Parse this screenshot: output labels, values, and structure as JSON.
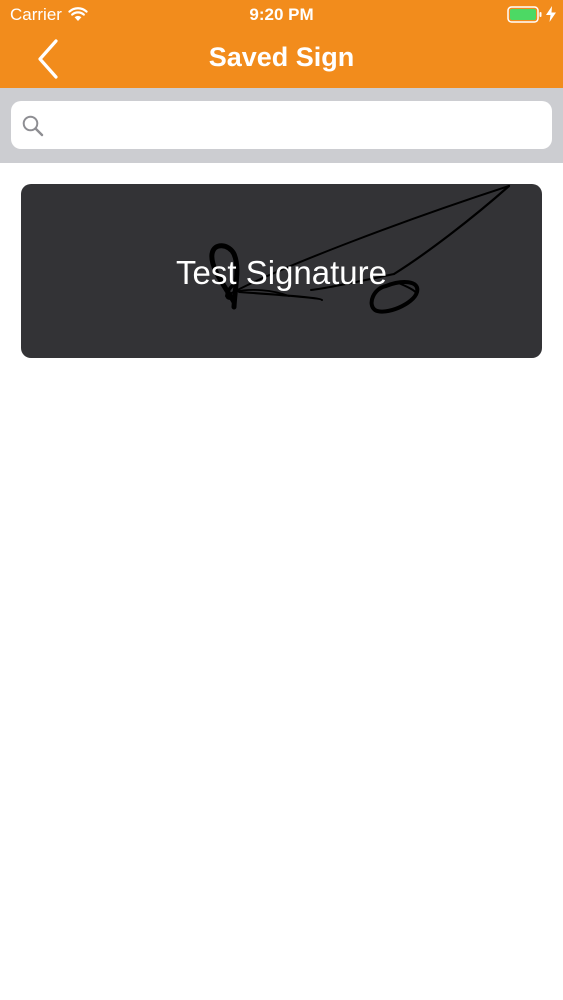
{
  "status_bar": {
    "carrier": "Carrier",
    "time": "9:20 PM",
    "icons": [
      "wifi-icon",
      "battery-icon",
      "charging-icon"
    ]
  },
  "nav_bar": {
    "title": "Saved Sign",
    "back_icon": "chevron-left-icon"
  },
  "search": {
    "placeholder": "",
    "value": "",
    "icon": "search-icon"
  },
  "signatures": [
    {
      "name": "Test Signature"
    }
  ],
  "colors": {
    "header": "#f28c1c",
    "search_area": "#cccdd1",
    "card": "#333336",
    "text_on_dark": "#ffffff"
  }
}
